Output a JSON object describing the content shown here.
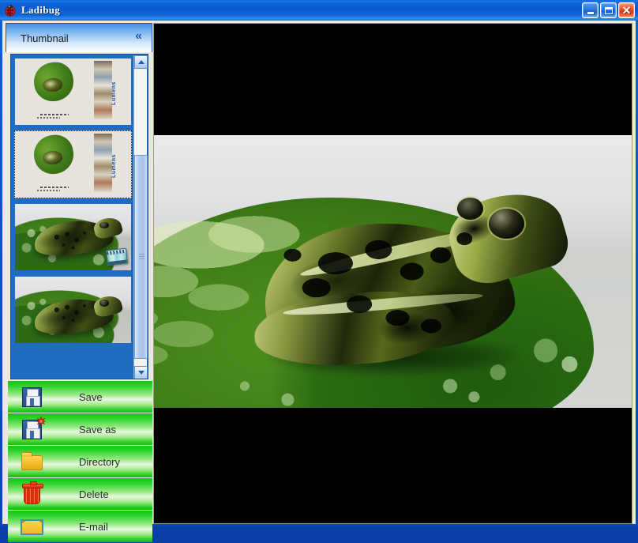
{
  "window": {
    "title": "Ladibug",
    "app_icon": "ladybug-icon",
    "caption_buttons": [
      {
        "name": "minimize-button",
        "glyph": "_",
        "color": "#2a7ae0"
      },
      {
        "name": "maximize-button",
        "glyph": "□",
        "color": "#2a7ae0"
      },
      {
        "name": "close-button",
        "glyph": "✕",
        "color": "#e8542a"
      }
    ]
  },
  "sidebar": {
    "panel_title": "Thumbnail",
    "collapse_icon": "«",
    "collapse_icon_name": "collapse-chevron-icon",
    "thumbnails": [
      {
        "index": 1,
        "kind": "document-page",
        "brand_text": "Lumens",
        "selected": true,
        "has_video_badge": false
      },
      {
        "index": 2,
        "kind": "document-page",
        "brand_text": "Lumens",
        "selected": false,
        "has_video_badge": false
      },
      {
        "index": 3,
        "kind": "frog-closeup",
        "brand_text": "",
        "selected": false,
        "has_video_badge": true
      },
      {
        "index": 4,
        "kind": "frog-closeup",
        "brand_text": "",
        "selected": false,
        "has_video_badge": false
      }
    ],
    "scrollbar": {
      "up_arrow": "▲",
      "down_arrow": "▼",
      "thumb_position_pct": 31,
      "thumb_size_pct": 63
    },
    "actions": [
      {
        "label": "Save",
        "icon": "floppy-disk-icon",
        "name": "save-button"
      },
      {
        "label": "Save as",
        "icon": "floppy-disk-star-icon",
        "name": "save-as-button"
      },
      {
        "label": "Directory",
        "icon": "folder-icon",
        "name": "directory-button"
      },
      {
        "label": "Delete",
        "icon": "trash-can-icon",
        "name": "delete-button"
      },
      {
        "label": "E-mail",
        "icon": "envelope-icon",
        "name": "email-button"
      }
    ]
  },
  "preview": {
    "subject": "leopard frog on a lily pad with water droplets",
    "letterbox_color": "#000000",
    "background_color": "#d9dada"
  },
  "colors": {
    "titlebar_blue": "#0a5ccf",
    "button_green": "#16c416",
    "panel_face": "#ece9d8",
    "selection_blue": "#1a6ec4"
  }
}
